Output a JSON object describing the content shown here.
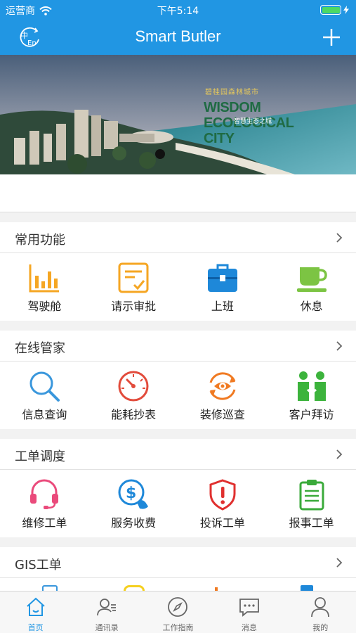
{
  "status_bar": {
    "carrier": "运营商",
    "time": "下午5:14"
  },
  "nav": {
    "title": "Smart Butler",
    "lang_icon_text_top": "中",
    "lang_icon_text_bottom": "En"
  },
  "banner": {
    "subtitle": "碧桂园森林城市",
    "title": "WISDOM ECOLOGICAL CITY",
    "title_line1": "WISDOM ECOLOGICAL",
    "title_line2": "CITY",
    "cn_caption": "智慧生态之城"
  },
  "sections": [
    {
      "title": "常用功能",
      "items": [
        {
          "label": "驾驶舱",
          "icon": "bar-chart-icon",
          "color": "#f5a623"
        },
        {
          "label": "请示审批",
          "icon": "approval-icon",
          "color": "#f5a623"
        },
        {
          "label": "上班",
          "icon": "briefcase-icon",
          "color": "#1e88d9"
        },
        {
          "label": "休息",
          "icon": "coffee-icon",
          "color": "#7cc443"
        }
      ]
    },
    {
      "title": "在线管家",
      "items": [
        {
          "label": "信息查询",
          "icon": "search-icon",
          "color": "#3a97dc"
        },
        {
          "label": "能耗抄表",
          "icon": "gauge-icon",
          "color": "#e24b3b"
        },
        {
          "label": "装修巡查",
          "icon": "eye-refresh-icon",
          "color": "#f07a22"
        },
        {
          "label": "客户拜访",
          "icon": "visit-icon",
          "color": "#3cb33c"
        }
      ]
    },
    {
      "title": "工单调度",
      "items": [
        {
          "label": "维修工单",
          "icon": "headset-icon",
          "color": "#ea4a7b"
        },
        {
          "label": "服务收费",
          "icon": "payment-icon",
          "color": "#1e88d9"
        },
        {
          "label": "投诉工单",
          "icon": "alert-shield-icon",
          "color": "#e0302f"
        },
        {
          "label": "报事工单",
          "icon": "clipboard-icon",
          "color": "#3aaa3a"
        }
      ]
    },
    {
      "title": "GIS工单"
    }
  ],
  "tabbar": [
    {
      "label": "首页",
      "icon": "home-icon",
      "active": true
    },
    {
      "label": "通讯录",
      "icon": "contacts-icon",
      "active": false
    },
    {
      "label": "工作指南",
      "icon": "compass-icon",
      "active": false
    },
    {
      "label": "消息",
      "icon": "message-icon",
      "active": false
    },
    {
      "label": "我的",
      "icon": "user-icon",
      "active": false
    }
  ],
  "colors": {
    "primary": "#2196e3",
    "battery": "#4cd964"
  }
}
